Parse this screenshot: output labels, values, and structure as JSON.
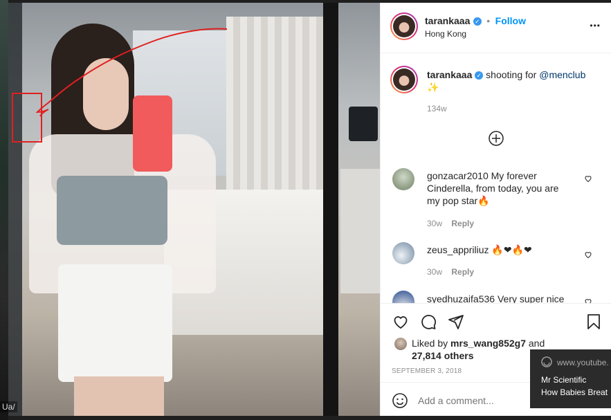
{
  "post": {
    "username": "tarankaaa",
    "location": "Hong Kong",
    "follow_label": "Follow",
    "caption_text": "shooting for",
    "caption_mention": "@menclub",
    "caption_emoji": "✨",
    "caption_time": "134w",
    "likes_prefix": "Liked by",
    "likes_user": "mrs_wang852g7",
    "likes_and": "and",
    "likes_others": "27,814 others",
    "date": "SEPTEMBER 3, 2018",
    "add_comment_placeholder": "Add a comment...",
    "more_label": "•••",
    "dot_sep": "•"
  },
  "comments": [
    {
      "user": "gonzacar2010",
      "text": "My forever Cinderella, from today, you are my pop star🔥",
      "time": "30w",
      "reply": "Reply"
    },
    {
      "user": "zeus_appriliuz",
      "text": "🔥❤🔥❤",
      "time": "30w",
      "reply": "Reply"
    },
    {
      "user": "syedhuzaifa536",
      "text": "Very super nice"
    }
  ],
  "overlay": {
    "site": "www.youtube.",
    "channel": "Mr Scientific",
    "title": "How Babies Breat"
  },
  "host_label": "Ua/",
  "colors": {
    "accent": "#0095f6",
    "verified": "#3897f0",
    "annotation": "#e0201f"
  }
}
